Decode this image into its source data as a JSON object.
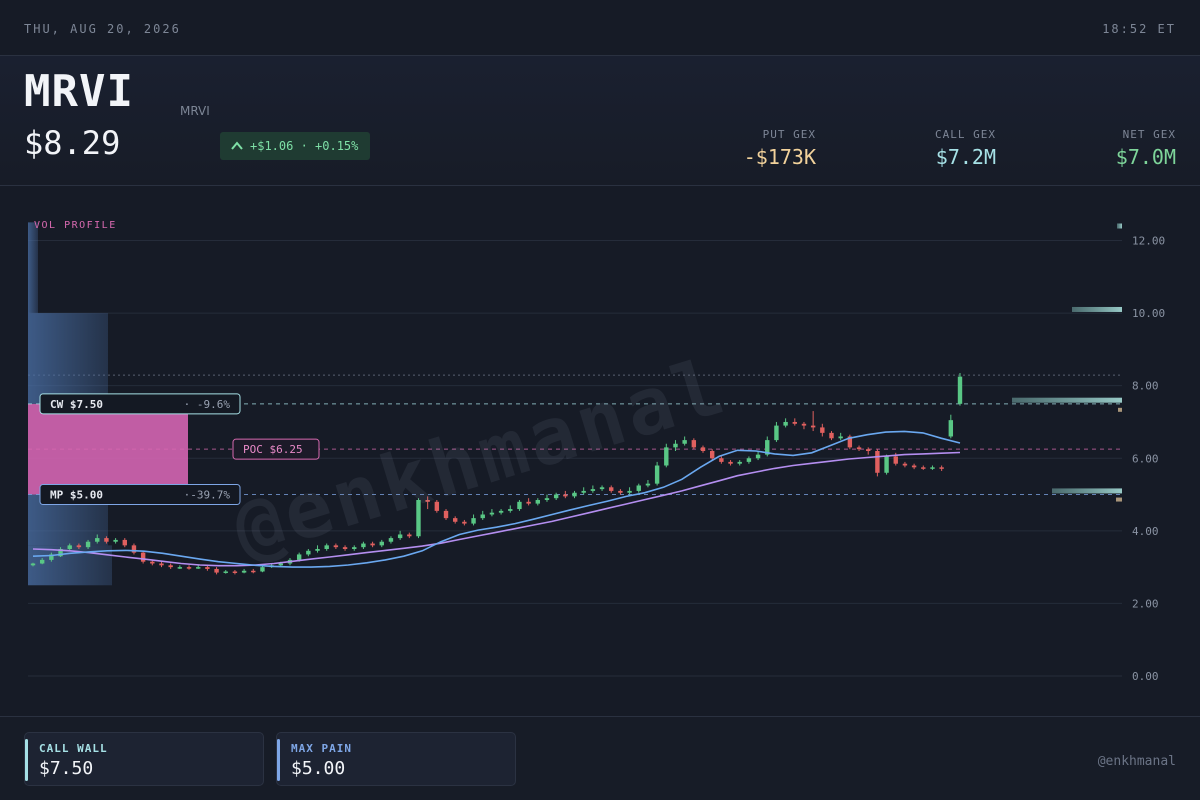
{
  "topbar": {
    "date": "THU, AUG 20, 2026",
    "time": "18:52 ET"
  },
  "header": {
    "ticker": "MRVI",
    "name": "MRVI",
    "price": "$8.29",
    "change": "+$1.06 · +0.15%",
    "stats": [
      {
        "label": "PUT GEX",
        "value": "-$173K",
        "color": "#f2d29b"
      },
      {
        "label": "CALL GEX",
        "value": "$7.2M",
        "color": "#a6e1e6"
      },
      {
        "label": "NET GEX",
        "value": "$7.0M",
        "color": "#7ed59a"
      }
    ]
  },
  "chart_data": {
    "type": "candlestick",
    "title": "VOL PROFILE",
    "watermark": "@enkhmanal",
    "ylim": [
      0,
      12.4
    ],
    "y_ticks": [
      "0.00",
      "2.00",
      "4.00",
      "6.00",
      "8.00",
      "10.00",
      "12.00"
    ],
    "levels": [
      {
        "name": "CW",
        "price": 7.5,
        "label": "CW $7.50",
        "pct": "· -9.6%",
        "color": "#a6e1e6"
      },
      {
        "name": "POC",
        "price": 6.25,
        "label": "POC $6.25",
        "color": "#d86ab0"
      },
      {
        "name": "MP",
        "price": 5.0,
        "label": "MP $5.00",
        "pct": "·-39.7%",
        "color": "#7ea6e6"
      }
    ],
    "current_price": 8.29,
    "volume_profile": [
      {
        "from": 2.5,
        "to": 3.6,
        "weight": 0.42
      },
      {
        "from": 3.6,
        "to": 5.0,
        "weight": 0.4
      },
      {
        "from": 5.0,
        "to": 7.5,
        "weight": 0.8,
        "poc": true
      },
      {
        "from": 7.5,
        "to": 10.0,
        "weight": 0.4
      },
      {
        "from": 10.0,
        "to": 12.5,
        "weight": 0.05
      }
    ],
    "gex_bars": [
      {
        "price": 12.4,
        "weight": 0.1
      },
      {
        "price": 10.1,
        "weight": 1.0
      },
      {
        "price": 7.6,
        "weight": 2.2
      },
      {
        "price": 5.1,
        "weight": 1.4
      }
    ],
    "candles": [
      [
        3.05,
        3.1,
        3.02,
        3.12
      ],
      [
        3.1,
        3.2,
        3.08,
        3.25
      ],
      [
        3.2,
        3.35,
        3.15,
        3.4
      ],
      [
        3.3,
        3.5,
        3.28,
        3.55
      ],
      [
        3.5,
        3.6,
        3.45,
        3.65
      ],
      [
        3.6,
        3.55,
        3.5,
        3.65
      ],
      [
        3.55,
        3.7,
        3.5,
        3.75
      ],
      [
        3.7,
        3.8,
        3.65,
        3.9
      ],
      [
        3.8,
        3.7,
        3.65,
        3.85
      ],
      [
        3.7,
        3.75,
        3.65,
        3.8
      ],
      [
        3.75,
        3.6,
        3.55,
        3.8
      ],
      [
        3.6,
        3.4,
        3.35,
        3.65
      ],
      [
        3.4,
        3.15,
        3.1,
        3.45
      ],
      [
        3.15,
        3.1,
        3.05,
        3.2
      ],
      [
        3.1,
        3.05,
        3.0,
        3.15
      ],
      [
        3.05,
        3.0,
        2.95,
        3.1
      ],
      [
        3.0,
        3.0,
        2.95,
        3.05
      ],
      [
        3.0,
        2.98,
        2.93,
        3.05
      ],
      [
        2.98,
        3.0,
        2.95,
        3.05
      ],
      [
        3.0,
        2.95,
        2.9,
        3.05
      ],
      [
        2.95,
        2.85,
        2.8,
        3.0
      ],
      [
        2.85,
        2.88,
        2.82,
        2.92
      ],
      [
        2.88,
        2.85,
        2.8,
        2.92
      ],
      [
        2.85,
        2.9,
        2.83,
        2.95
      ],
      [
        2.9,
        2.88,
        2.83,
        2.95
      ],
      [
        2.88,
        3.0,
        2.86,
        3.05
      ],
      [
        3.0,
        3.05,
        2.98,
        3.1
      ],
      [
        3.05,
        3.1,
        3.02,
        3.15
      ],
      [
        3.1,
        3.2,
        3.05,
        3.25
      ],
      [
        3.2,
        3.35,
        3.15,
        3.4
      ],
      [
        3.35,
        3.45,
        3.3,
        3.5
      ],
      [
        3.45,
        3.5,
        3.4,
        3.6
      ],
      [
        3.5,
        3.6,
        3.45,
        3.65
      ],
      [
        3.6,
        3.55,
        3.5,
        3.65
      ],
      [
        3.55,
        3.5,
        3.45,
        3.6
      ],
      [
        3.5,
        3.55,
        3.45,
        3.6
      ],
      [
        3.55,
        3.65,
        3.5,
        3.7
      ],
      [
        3.65,
        3.6,
        3.55,
        3.7
      ],
      [
        3.6,
        3.7,
        3.55,
        3.75
      ],
      [
        3.7,
        3.8,
        3.65,
        3.85
      ],
      [
        3.8,
        3.9,
        3.75,
        4.0
      ],
      [
        3.9,
        3.85,
        3.8,
        3.95
      ],
      [
        3.85,
        4.85,
        3.8,
        4.9
      ],
      [
        4.85,
        4.8,
        4.6,
        4.95
      ],
      [
        4.8,
        4.55,
        4.5,
        4.85
      ],
      [
        4.55,
        4.35,
        4.3,
        4.6
      ],
      [
        4.35,
        4.25,
        4.2,
        4.4
      ],
      [
        4.25,
        4.2,
        4.15,
        4.3
      ],
      [
        4.2,
        4.35,
        4.15,
        4.45
      ],
      [
        4.35,
        4.45,
        4.3,
        4.55
      ],
      [
        4.45,
        4.5,
        4.4,
        4.6
      ],
      [
        4.5,
        4.55,
        4.45,
        4.6
      ],
      [
        4.55,
        4.6,
        4.5,
        4.7
      ],
      [
        4.6,
        4.8,
        4.55,
        4.85
      ],
      [
        4.8,
        4.75,
        4.7,
        4.9
      ],
      [
        4.75,
        4.85,
        4.7,
        4.9
      ],
      [
        4.85,
        4.9,
        4.8,
        5.0
      ],
      [
        4.9,
        5.0,
        4.85,
        5.05
      ],
      [
        5.0,
        4.95,
        4.9,
        5.1
      ],
      [
        4.95,
        5.05,
        4.9,
        5.1
      ],
      [
        5.05,
        5.1,
        5.0,
        5.2
      ],
      [
        5.1,
        5.15,
        5.05,
        5.25
      ],
      [
        5.15,
        5.2,
        5.1,
        5.25
      ],
      [
        5.2,
        5.1,
        5.05,
        5.25
      ],
      [
        5.1,
        5.05,
        5.0,
        5.15
      ],
      [
        5.05,
        5.1,
        5.0,
        5.2
      ],
      [
        5.1,
        5.25,
        5.05,
        5.3
      ],
      [
        5.25,
        5.3,
        5.2,
        5.4
      ],
      [
        5.3,
        5.8,
        5.25,
        5.9
      ],
      [
        5.8,
        6.3,
        5.75,
        6.4
      ],
      [
        6.3,
        6.4,
        6.2,
        6.5
      ],
      [
        6.4,
        6.5,
        6.35,
        6.6
      ],
      [
        6.5,
        6.3,
        6.25,
        6.55
      ],
      [
        6.3,
        6.2,
        6.15,
        6.35
      ],
      [
        6.2,
        6.0,
        5.95,
        6.25
      ],
      [
        6.0,
        5.9,
        5.85,
        6.05
      ],
      [
        5.9,
        5.85,
        5.8,
        5.95
      ],
      [
        5.85,
        5.9,
        5.8,
        5.95
      ],
      [
        5.9,
        6.0,
        5.85,
        6.05
      ],
      [
        6.0,
        6.1,
        5.95,
        6.2
      ],
      [
        6.1,
        6.5,
        6.05,
        6.6
      ],
      [
        6.5,
        6.9,
        6.45,
        7.0
      ],
      [
        6.9,
        7.0,
        6.85,
        7.1
      ],
      [
        7.0,
        6.95,
        6.9,
        7.1
      ],
      [
        6.95,
        6.9,
        6.8,
        7.0
      ],
      [
        6.9,
        6.85,
        6.75,
        7.3
      ],
      [
        6.85,
        6.7,
        6.6,
        6.95
      ],
      [
        6.7,
        6.55,
        6.5,
        6.75
      ],
      [
        6.55,
        6.6,
        6.5,
        6.7
      ],
      [
        6.6,
        6.3,
        6.25,
        6.65
      ],
      [
        6.3,
        6.25,
        6.2,
        6.35
      ],
      [
        6.25,
        6.2,
        6.1,
        6.3
      ],
      [
        6.2,
        5.6,
        5.5,
        6.25
      ],
      [
        5.6,
        6.05,
        5.55,
        6.1
      ],
      [
        6.05,
        5.85,
        5.8,
        6.15
      ],
      [
        5.85,
        5.8,
        5.75,
        5.9
      ],
      [
        5.8,
        5.75,
        5.7,
        5.85
      ],
      [
        5.75,
        5.72,
        5.68,
        5.8
      ],
      [
        5.72,
        5.75,
        5.68,
        5.8
      ],
      [
        5.75,
        5.72,
        5.65,
        5.8
      ],
      [
        6.6,
        7.05,
        6.55,
        7.2
      ],
      [
        7.5,
        8.25,
        7.45,
        8.35
      ]
    ],
    "ma_fast": [
      3.3,
      3.32,
      3.38,
      3.42,
      3.45,
      3.46,
      3.44,
      3.38,
      3.3,
      3.22,
      3.15,
      3.1,
      3.05,
      3.02,
      3.0,
      3.0,
      3.02,
      3.06,
      3.12,
      3.2,
      3.3,
      3.45,
      3.7,
      3.9,
      4.02,
      4.1,
      4.2,
      4.32,
      4.45,
      4.58,
      4.7,
      4.82,
      4.95,
      5.05,
      5.2,
      5.42,
      5.75,
      6.05,
      6.22,
      6.2,
      6.12,
      6.08,
      6.15,
      6.35,
      6.55,
      6.65,
      6.72,
      6.74,
      6.7,
      6.55,
      6.42
    ],
    "ma_slow": [
      3.5,
      3.48,
      3.45,
      3.4,
      3.34,
      3.28,
      3.22,
      3.16,
      3.1,
      3.06,
      3.04,
      3.04,
      3.06,
      3.1,
      3.16,
      3.22,
      3.28,
      3.34,
      3.4,
      3.46,
      3.52,
      3.58,
      3.66,
      3.76,
      3.86,
      3.96,
      4.06,
      4.16,
      4.26,
      4.38,
      4.5,
      4.62,
      4.74,
      4.86,
      4.98,
      5.1,
      5.24,
      5.38,
      5.52,
      5.62,
      5.72,
      5.8,
      5.86,
      5.92,
      5.98,
      6.02,
      6.06,
      6.1,
      6.12,
      6.14,
      6.16
    ]
  },
  "footer": {
    "cards": [
      {
        "label": "CALL WALL",
        "value": "$7.50",
        "color": "#a6e1e6"
      },
      {
        "label": "MAX PAIN",
        "value": "$5.00",
        "color": "#7ea6e6"
      }
    ],
    "handle": "@enkhmanal"
  }
}
